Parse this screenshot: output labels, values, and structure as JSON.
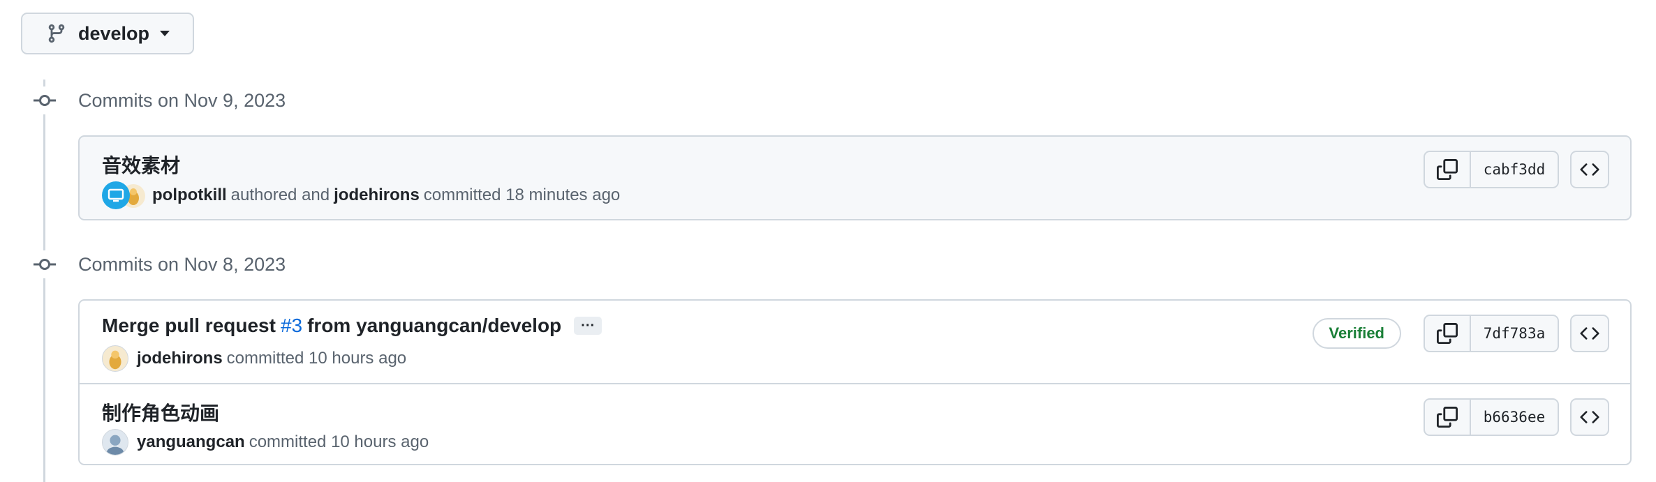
{
  "branch": {
    "name": "develop"
  },
  "groups": [
    {
      "title": "Commits on Nov 9, 2023",
      "commits": [
        {
          "title": "音效素材",
          "author": "polpotkill",
          "authored_text": "authored and",
          "committer": "jodehirons",
          "committed_text": "committed 18 minutes ago",
          "sha": "cabf3dd"
        }
      ]
    },
    {
      "title": "Commits on Nov 8, 2023",
      "commits": [
        {
          "title_prefix": "Merge pull request",
          "pr_number": "#3",
          "title_suffix": "from yanguangcan/develop",
          "ellipsis": "···",
          "committer": "jodehirons",
          "committed_text": "committed 10 hours ago",
          "badge": "Verified",
          "sha": "7df783a"
        },
        {
          "title": "制作角色动画",
          "committer": "yanguangcan",
          "committed_text": "committed 10 hours ago",
          "sha": "b6636ee"
        }
      ]
    }
  ],
  "colors": {
    "accent_link": "#0969da",
    "verified_green": "#1a7f37",
    "muted_text": "#59636e",
    "border": "#d0d7de"
  },
  "icons": [
    "git-branch-icon",
    "caret-down-icon",
    "git-commit-icon",
    "copy-icon",
    "code-icon"
  ]
}
